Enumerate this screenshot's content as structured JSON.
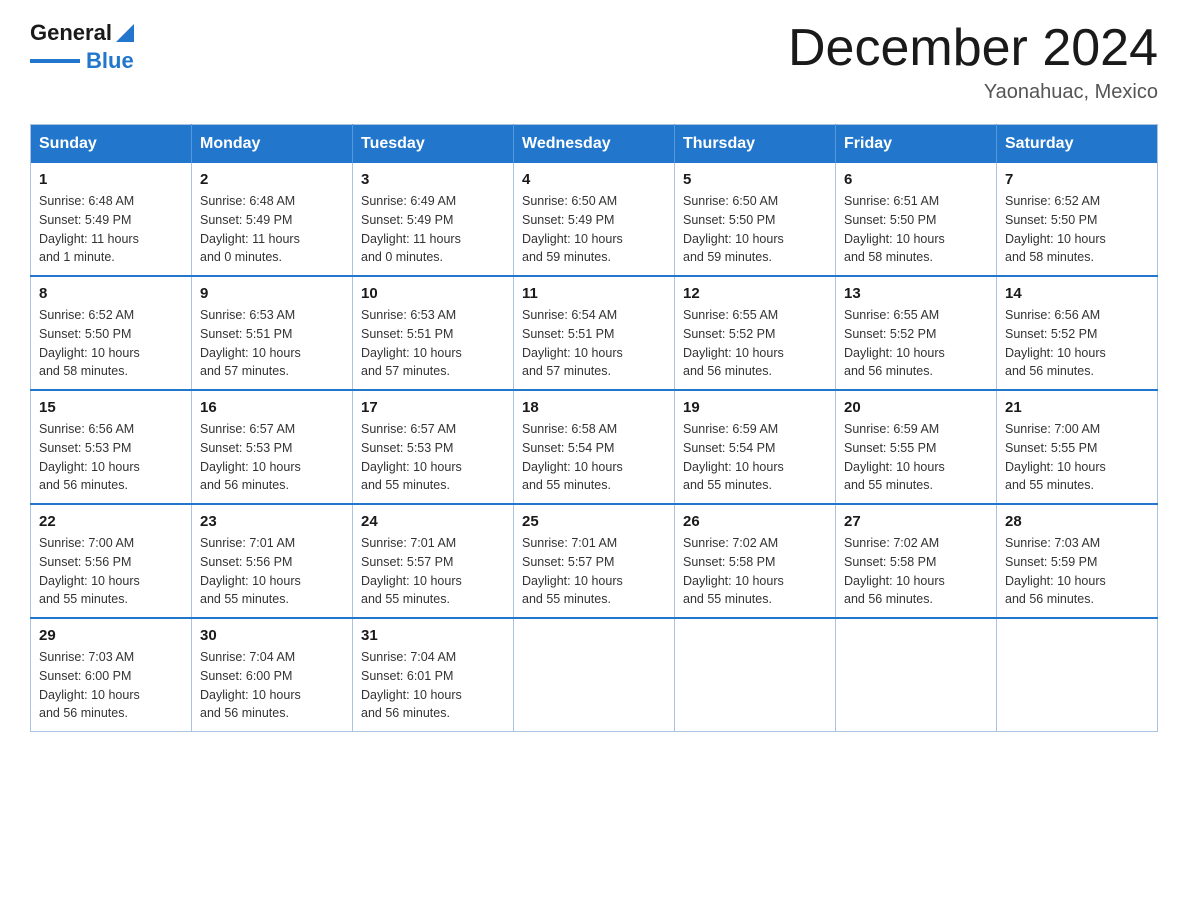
{
  "header": {
    "logo_text_general": "General",
    "logo_text_blue": "Blue",
    "title": "December 2024",
    "subtitle": "Yaonahuac, Mexico"
  },
  "calendar": {
    "days_of_week": [
      "Sunday",
      "Monday",
      "Tuesday",
      "Wednesday",
      "Thursday",
      "Friday",
      "Saturday"
    ],
    "weeks": [
      [
        {
          "day": "1",
          "sunrise": "6:48 AM",
          "sunset": "5:49 PM",
          "daylight": "11 hours and 1 minute."
        },
        {
          "day": "2",
          "sunrise": "6:48 AM",
          "sunset": "5:49 PM",
          "daylight": "11 hours and 0 minutes."
        },
        {
          "day": "3",
          "sunrise": "6:49 AM",
          "sunset": "5:49 PM",
          "daylight": "11 hours and 0 minutes."
        },
        {
          "day": "4",
          "sunrise": "6:50 AM",
          "sunset": "5:49 PM",
          "daylight": "10 hours and 59 minutes."
        },
        {
          "day": "5",
          "sunrise": "6:50 AM",
          "sunset": "5:50 PM",
          "daylight": "10 hours and 59 minutes."
        },
        {
          "day": "6",
          "sunrise": "6:51 AM",
          "sunset": "5:50 PM",
          "daylight": "10 hours and 58 minutes."
        },
        {
          "day": "7",
          "sunrise": "6:52 AM",
          "sunset": "5:50 PM",
          "daylight": "10 hours and 58 minutes."
        }
      ],
      [
        {
          "day": "8",
          "sunrise": "6:52 AM",
          "sunset": "5:50 PM",
          "daylight": "10 hours and 58 minutes."
        },
        {
          "day": "9",
          "sunrise": "6:53 AM",
          "sunset": "5:51 PM",
          "daylight": "10 hours and 57 minutes."
        },
        {
          "day": "10",
          "sunrise": "6:53 AM",
          "sunset": "5:51 PM",
          "daylight": "10 hours and 57 minutes."
        },
        {
          "day": "11",
          "sunrise": "6:54 AM",
          "sunset": "5:51 PM",
          "daylight": "10 hours and 57 minutes."
        },
        {
          "day": "12",
          "sunrise": "6:55 AM",
          "sunset": "5:52 PM",
          "daylight": "10 hours and 56 minutes."
        },
        {
          "day": "13",
          "sunrise": "6:55 AM",
          "sunset": "5:52 PM",
          "daylight": "10 hours and 56 minutes."
        },
        {
          "day": "14",
          "sunrise": "6:56 AM",
          "sunset": "5:52 PM",
          "daylight": "10 hours and 56 minutes."
        }
      ],
      [
        {
          "day": "15",
          "sunrise": "6:56 AM",
          "sunset": "5:53 PM",
          "daylight": "10 hours and 56 minutes."
        },
        {
          "day": "16",
          "sunrise": "6:57 AM",
          "sunset": "5:53 PM",
          "daylight": "10 hours and 56 minutes."
        },
        {
          "day": "17",
          "sunrise": "6:57 AM",
          "sunset": "5:53 PM",
          "daylight": "10 hours and 55 minutes."
        },
        {
          "day": "18",
          "sunrise": "6:58 AM",
          "sunset": "5:54 PM",
          "daylight": "10 hours and 55 minutes."
        },
        {
          "day": "19",
          "sunrise": "6:59 AM",
          "sunset": "5:54 PM",
          "daylight": "10 hours and 55 minutes."
        },
        {
          "day": "20",
          "sunrise": "6:59 AM",
          "sunset": "5:55 PM",
          "daylight": "10 hours and 55 minutes."
        },
        {
          "day": "21",
          "sunrise": "7:00 AM",
          "sunset": "5:55 PM",
          "daylight": "10 hours and 55 minutes."
        }
      ],
      [
        {
          "day": "22",
          "sunrise": "7:00 AM",
          "sunset": "5:56 PM",
          "daylight": "10 hours and 55 minutes."
        },
        {
          "day": "23",
          "sunrise": "7:01 AM",
          "sunset": "5:56 PM",
          "daylight": "10 hours and 55 minutes."
        },
        {
          "day": "24",
          "sunrise": "7:01 AM",
          "sunset": "5:57 PM",
          "daylight": "10 hours and 55 minutes."
        },
        {
          "day": "25",
          "sunrise": "7:01 AM",
          "sunset": "5:57 PM",
          "daylight": "10 hours and 55 minutes."
        },
        {
          "day": "26",
          "sunrise": "7:02 AM",
          "sunset": "5:58 PM",
          "daylight": "10 hours and 55 minutes."
        },
        {
          "day": "27",
          "sunrise": "7:02 AM",
          "sunset": "5:58 PM",
          "daylight": "10 hours and 56 minutes."
        },
        {
          "day": "28",
          "sunrise": "7:03 AM",
          "sunset": "5:59 PM",
          "daylight": "10 hours and 56 minutes."
        }
      ],
      [
        {
          "day": "29",
          "sunrise": "7:03 AM",
          "sunset": "6:00 PM",
          "daylight": "10 hours and 56 minutes."
        },
        {
          "day": "30",
          "sunrise": "7:04 AM",
          "sunset": "6:00 PM",
          "daylight": "10 hours and 56 minutes."
        },
        {
          "day": "31",
          "sunrise": "7:04 AM",
          "sunset": "6:01 PM",
          "daylight": "10 hours and 56 minutes."
        },
        null,
        null,
        null,
        null
      ]
    ],
    "labels": {
      "sunrise": "Sunrise:",
      "sunset": "Sunset:",
      "daylight": "Daylight:"
    }
  }
}
